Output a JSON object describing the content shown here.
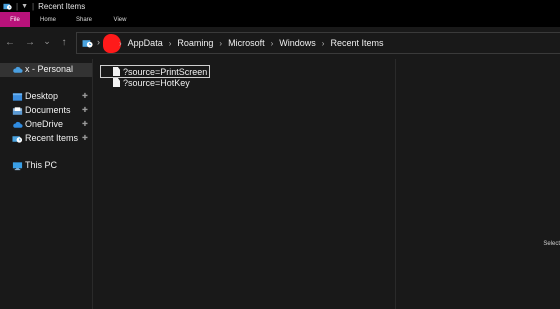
{
  "window": {
    "title": "Recent Items",
    "quick_access_glyph": "▼"
  },
  "ribbon": {
    "tabs": [
      {
        "label": "File",
        "active": true
      },
      {
        "label": "Home"
      },
      {
        "label": "Share"
      },
      {
        "label": "View"
      }
    ],
    "file_color": "#b8127a"
  },
  "navigation": {
    "back_icon": "←",
    "forward_icon": "→",
    "recent_icon": "⌄",
    "up_icon": "↑",
    "separator_glyph": "›",
    "breadcrumbs": [
      "AppData",
      "Roaming",
      "Microsoft",
      "Windows",
      "Recent Items"
    ],
    "redaction_color": "#ff1a1a"
  },
  "sidebar": {
    "items": [
      {
        "label": "x - Personal",
        "icon": "cloud-icon",
        "selected": true
      },
      {
        "label": "Desktop",
        "icon": "desktop-folder-icon",
        "pinned": true
      },
      {
        "label": "Documents",
        "icon": "documents-folder-icon",
        "pinned": true
      },
      {
        "label": "OneDrive",
        "icon": "onedrive-cloud-icon",
        "pinned": true
      },
      {
        "label": "Recent Items",
        "icon": "recent-items-icon",
        "pinned": true
      },
      {
        "label": "This PC",
        "icon": "computer-monitor-icon"
      }
    ],
    "pin_glyph": "✚"
  },
  "files": [
    {
      "name": "?source=PrintScreen",
      "focused": true
    },
    {
      "name": "?source=HotKey",
      "focused": false
    }
  ],
  "details": {
    "hint": "Select"
  }
}
